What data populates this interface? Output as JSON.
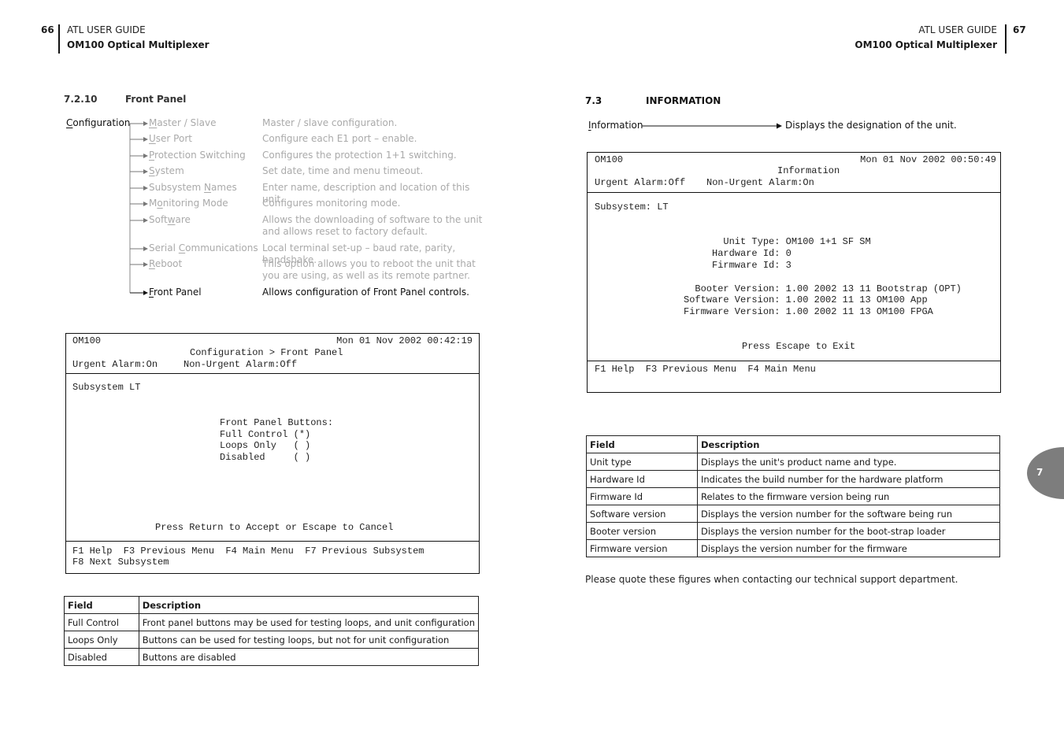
{
  "left_page": {
    "header": {
      "page_number": "66",
      "guide": "ATL USER GUIDE",
      "product": "OM100 Optical Multiplexer"
    },
    "section": {
      "number": "7.2.10",
      "title": "Front Panel"
    },
    "menu_tree": {
      "root": {
        "label": "Configuration",
        "underline": "C",
        "rest": "onfiguration"
      },
      "items": [
        {
          "pre": "",
          "u": "M",
          "post": "aster / Slave",
          "desc": "Master / slave configuration.",
          "active": false
        },
        {
          "pre": "",
          "u": "U",
          "post": "ser Port",
          "desc": "Configure each E1 port – enable.",
          "active": false
        },
        {
          "pre": "",
          "u": "P",
          "post": "rotection Switching",
          "desc": "Configures the protection 1+1 switching.",
          "active": false
        },
        {
          "pre": "",
          "u": "S",
          "post": "ystem",
          "desc": "Set date, time and menu timeout.",
          "active": false
        },
        {
          "pre": "Subsystem ",
          "u": "N",
          "post": "ames",
          "desc": "Enter name, description and location of this unit.",
          "active": false
        },
        {
          "pre": "M",
          "u": "o",
          "post": "nitoring Mode",
          "desc": "Configures monitoring mode.",
          "active": false
        },
        {
          "pre": "Soft",
          "u": "w",
          "post": "are",
          "desc": "Allows the downloading of software to the unit and allows reset to factory default.",
          "active": false
        },
        {
          "pre": "Serial ",
          "u": "C",
          "post": "ommunications",
          "desc": "Local terminal set-up – baud rate, parity, handshake.",
          "active": false
        },
        {
          "pre": "",
          "u": "R",
          "post": "eboot",
          "desc": "This option allows you to reboot the unit that you are using, as well as its remote partner.",
          "active": false
        },
        {
          "pre": "",
          "u": "F",
          "post": "ront Panel",
          "desc": "Allows configuration of Front Panel controls.",
          "active": true
        }
      ]
    },
    "terminal": {
      "device": "OM100",
      "datetime": "Mon 01 Nov 2002 00:42:19",
      "breadcrumb": "Configuration > Front Panel",
      "urgent_alarm": "Urgent Alarm:On",
      "non_urgent_alarm": "Non-Urgent Alarm:Off",
      "subsystem": "Subsystem LT",
      "options_title": "Front Panel Buttons:",
      "options": [
        {
          "label": "Full Control",
          "mark": "(*)"
        },
        {
          "label": "Loops Only  ",
          "mark": "( )"
        },
        {
          "label": "Disabled    ",
          "mark": "( )"
        }
      ],
      "prompt": "Press Return to Accept or Escape to Cancel",
      "fkeys_line1": "F1 Help  F3 Previous Menu  F4 Main Menu  F7 Previous Subsystem",
      "fkeys_line2": "F8 Next Subsystem"
    },
    "table": {
      "headers": [
        "Field",
        "Description"
      ],
      "rows": [
        [
          "Full Control",
          "Front panel buttons may be used for testing loops, and unit configuration"
        ],
        [
          "Loops Only",
          "Buttons can be used for testing loops, but not for unit configuration"
        ],
        [
          "Disabled",
          "Buttons are disabled"
        ]
      ]
    }
  },
  "right_page": {
    "header": {
      "page_number": "67",
      "guide": "ATL USER GUIDE",
      "product": "OM100 Optical Multiplexer"
    },
    "section": {
      "number": "7.3",
      "title": "INFORMATION"
    },
    "menu": {
      "underline": "I",
      "rest": "nformation",
      "desc": "Displays the designation of the unit."
    },
    "terminal": {
      "device": "OM100",
      "datetime": "Mon 01 Nov 2002 00:50:49",
      "title": "Information",
      "urgent_alarm": "Urgent Alarm:Off",
      "non_urgent_alarm": "Non-Urgent Alarm:On",
      "subsystem": "Subsystem: LT",
      "info_lines": [
        "       Unit Type: OM100 1+1 SF SM",
        "     Hardware Id: 0",
        "     Firmware Id: 3",
        "",
        "  Booter Version: 1.00 2002 13 11 Bootstrap (OPT)",
        "Software Version: 1.00 2002 11 13 OM100 App",
        "Firmware Version: 1.00 2002 11 13 OM100 FPGA"
      ],
      "prompt": "Press Escape to Exit",
      "fkeys": "F1 Help  F3 Previous Menu  F4 Main Menu"
    },
    "table": {
      "headers": [
        "Field",
        "Description"
      ],
      "rows": [
        [
          "Unit type",
          "Displays the unit's product name and type."
        ],
        [
          "Hardware Id",
          "Indicates the build number for the hardware platform"
        ],
        [
          "Firmware Id",
          "Relates to the firmware version being run"
        ],
        [
          "Software version",
          "Displays the version number for the software being run"
        ],
        [
          "Booter version",
          "Displays the version number for the boot-strap loader"
        ],
        [
          "Firmware version",
          "Displays the version number for the firmware"
        ]
      ]
    },
    "note": "Please quote these figures when contacting our technical support department.",
    "chapter_tab": "7"
  }
}
